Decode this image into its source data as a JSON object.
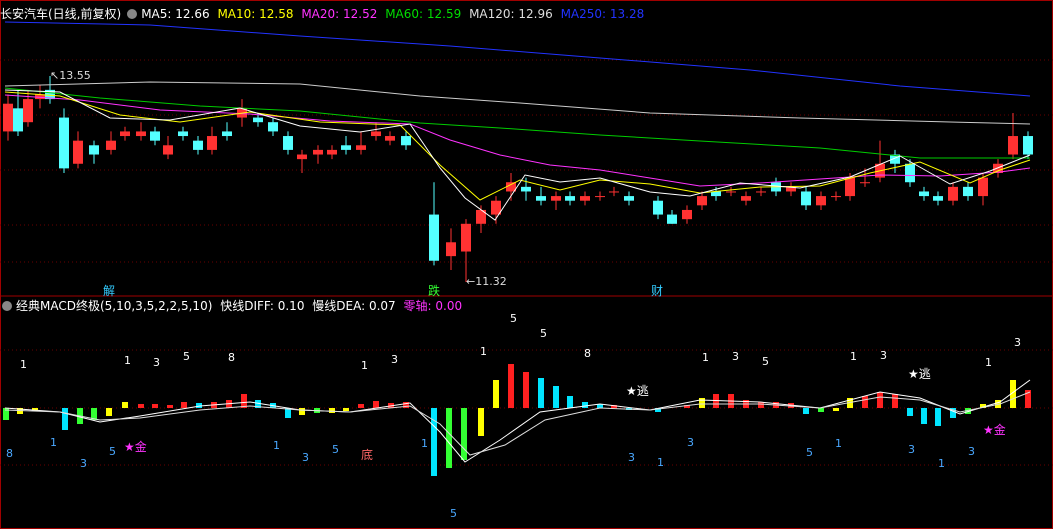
{
  "price_panel": {
    "title": "长安汽车(日线,前复权)",
    "indicators": [
      {
        "label": "MA5: 12.66",
        "color": "#ffffff"
      },
      {
        "label": "MA10: 12.58",
        "color": "#ffff00"
      },
      {
        "label": "MA20: 12.52",
        "color": "#ff33ff"
      },
      {
        "label": "MA60: 12.59",
        "color": "#00dd00"
      },
      {
        "label": "MA120: 12.96",
        "color": "#dddddd"
      },
      {
        "label": "MA250: 13.28",
        "color": "#2233ff"
      }
    ],
    "high_label": "13.55",
    "low_label": "11.32",
    "markers": [
      {
        "text": "解",
        "color": "#33ccff"
      },
      {
        "text": "跌",
        "color": "#33ff33"
      },
      {
        "text": "财",
        "color": "#33ccff"
      }
    ]
  },
  "macd_panel": {
    "title": "经典MACD终极(5,10,3,5,2,2,5,10)",
    "diff_label": "快线DIFF: 0.10",
    "dea_label": "慢线DEA: 0.07",
    "zero_label": "零轴: 0.00",
    "zero_color": "#ff33ff",
    "signals": [
      {
        "text": "★金",
        "color": "#ff33ff"
      },
      {
        "text": "★逃",
        "color": "#ffffff"
      },
      {
        "text": "★逃",
        "color": "#ffffff"
      },
      {
        "text": "★金",
        "color": "#ff33ff"
      },
      {
        "text": "底",
        "color": "#ff6666"
      }
    ],
    "upper_numbers": [
      "1",
      "1",
      "3",
      "5",
      "8",
      "1",
      "3",
      "1",
      "5",
      "8",
      "1",
      "3",
      "5",
      "1",
      "3",
      "1",
      "3",
      "5"
    ],
    "lower_numbers": [
      "8",
      "1",
      "3",
      "5",
      "1",
      "3",
      "5",
      "1",
      "3",
      "1",
      "3",
      "5",
      "1",
      "3",
      "1",
      "3",
      "5",
      "3"
    ]
  }
}
